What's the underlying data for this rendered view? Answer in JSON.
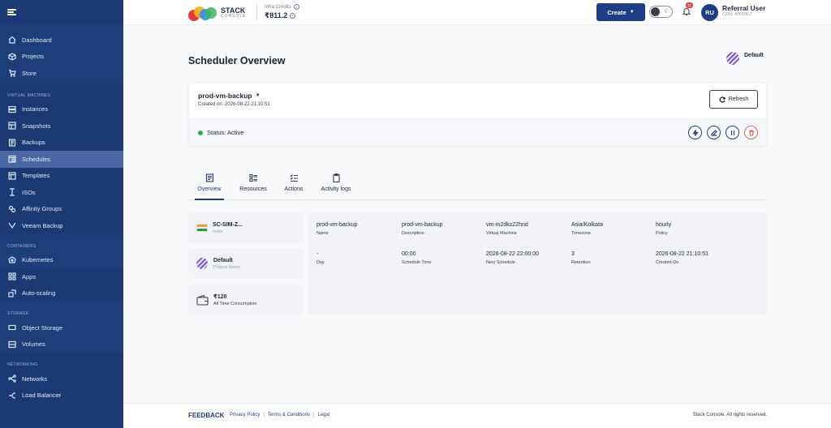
{
  "sidebar": {
    "top_items": [
      {
        "label": "Dashboard",
        "icon": "home-icon"
      },
      {
        "label": "Projects",
        "icon": "cube-icon"
      },
      {
        "label": "Store",
        "icon": "cart-icon"
      }
    ],
    "vm_heading": "VIRTUAL MACHINES",
    "vm_items": [
      {
        "label": "Instances",
        "icon": "server-icon"
      },
      {
        "label": "Snapshots",
        "icon": "snapshot-icon"
      },
      {
        "label": "Backups",
        "icon": "backup-icon"
      },
      {
        "label": "Schedules",
        "icon": "schedule-icon"
      },
      {
        "label": "Templates",
        "icon": "template-icon"
      },
      {
        "label": "ISOs",
        "icon": "iso-icon"
      },
      {
        "label": "Affinity Groups",
        "icon": "affinity-icon"
      },
      {
        "label": "Veeam Backup",
        "icon": "veeam-icon"
      }
    ],
    "containers_heading": "CONTAINERS",
    "container_items": [
      {
        "label": "Kubernetes",
        "icon": "kubernetes-icon"
      },
      {
        "label": "Apps",
        "icon": "apps-icon"
      },
      {
        "label": "Auto-scaling",
        "icon": "autoscale-icon"
      }
    ],
    "storage_heading": "STORAGE",
    "storage_items": [
      {
        "label": "Object Storage",
        "icon": "bucket-icon"
      },
      {
        "label": "Volumes",
        "icon": "volume-icon"
      }
    ],
    "networking_heading": "NETWORKING",
    "networking_items": [
      {
        "label": "Networks",
        "icon": "network-icon"
      },
      {
        "label": "Load Balancer",
        "icon": "loadbalancer-icon"
      }
    ]
  },
  "header": {
    "logo_line1": "STACK",
    "logo_line2": "CONSOLE",
    "credits_label": "Infra Credits",
    "credits_value": "₹811.2",
    "create_label": "Create",
    "notification_count": "11",
    "avatar_initials": "RU",
    "user_name": "Referral User",
    "user_crn": "CRN: #001067"
  },
  "main": {
    "page_title": "Scheduler Overview",
    "project_name": "Default",
    "schedule_name": "prod-vm-backup",
    "created_on": "Created on: 2026-08-22 21:10:51",
    "refresh_label": "Refresh",
    "status_text": "Status: Active",
    "tabs": [
      {
        "label": "Overview"
      },
      {
        "label": "Resources"
      },
      {
        "label": "Actions"
      },
      {
        "label": "Activity logs"
      }
    ],
    "info_region": {
      "title": "SC-SIM-Z...",
      "subtitle": "India"
    },
    "info_project": {
      "title": "Default",
      "subtitle": "Project Name"
    },
    "info_consumption": {
      "title": "₹120",
      "subtitle": "All Time Consumption"
    },
    "details": [
      {
        "value": "prod-vm-backup",
        "key": "Name"
      },
      {
        "value": "prod-vm-backup",
        "key": "Description"
      },
      {
        "value": "vm-m2dkz22hnd",
        "key": "Virtual Machine"
      },
      {
        "value": "Asia/Kolkata",
        "key": "Timezone"
      },
      {
        "value": "hourly",
        "key": "Policy"
      },
      {
        "value": "-",
        "key": "Day"
      },
      {
        "value": "00:00",
        "key": "Schedule Time"
      },
      {
        "value": "2026-08-22 22:00:00",
        "key": "Next Schedule"
      },
      {
        "value": "3",
        "key": "Retention"
      },
      {
        "value": "2026-08-22 21:10:51",
        "key": "Created On"
      }
    ]
  },
  "footer": {
    "feedback": "FEEDBACK",
    "privacy": "Privacy Policy",
    "terms": "Terms & Conditions",
    "legal": "Legal",
    "copyright": "Stack Console. All rights reserved."
  },
  "colors": {
    "sidebar_bg": "#1b3a73",
    "sidebar_active": "#4a67a3",
    "primary": "#1d3e84",
    "status_active": "#27ae4f",
    "danger": "#e06464"
  }
}
